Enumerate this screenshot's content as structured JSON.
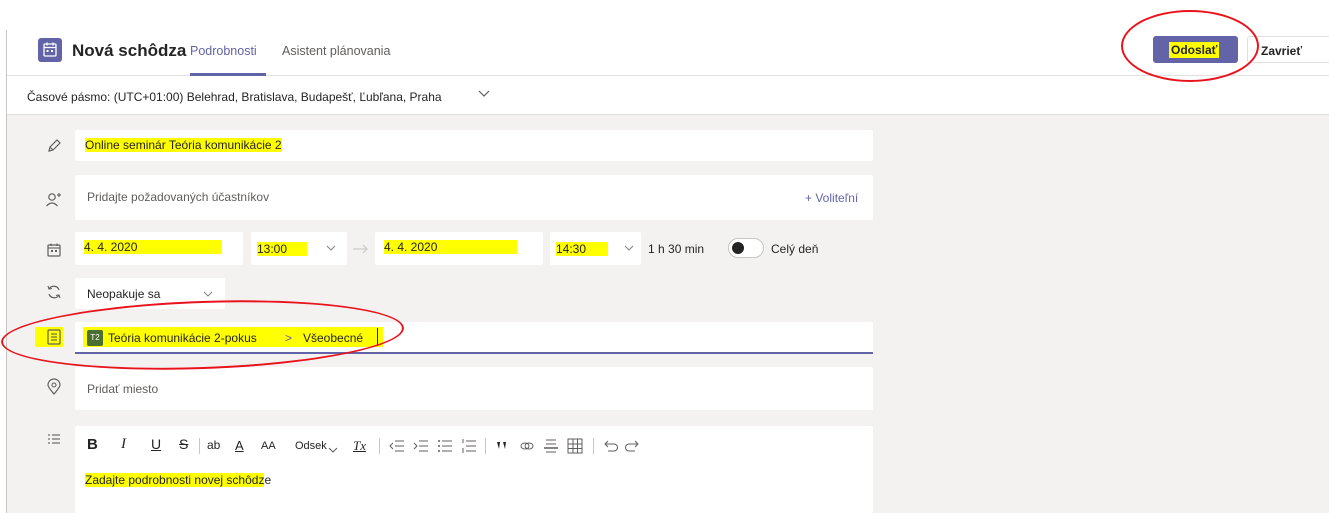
{
  "header": {
    "title": "Nová schôdza",
    "tabs": [
      {
        "label": "Podrobnosti",
        "active": true
      },
      {
        "label": "Asistent plánovania",
        "active": false
      }
    ],
    "send_label": "Odoslať",
    "close_label": "Zavrieť"
  },
  "timezone": {
    "label": "Časové pásmo: (UTC+01:00) Belehrad, Bratislava, Budapešť, Ľubľana, Praha"
  },
  "form": {
    "title_value": "Online seminár Teória komunikácie 2",
    "attendees_placeholder": "Pridajte požadovaných účastníkov",
    "optional_label": "+ Voliteľní",
    "start_date": "4. 4. 2020",
    "start_time": "13:00",
    "end_date": "4. 4. 2020",
    "end_time": "14:30",
    "duration": "1 h 30 min",
    "all_day_label": "Celý deň",
    "all_day_on": false,
    "recurrence": "Neopakuje sa",
    "team_badge": "T2",
    "team": "Teória komunikácie 2-pokus",
    "channel_separator": ">",
    "channel": "Všeobecné",
    "location_placeholder": "Pridať miesto"
  },
  "editor": {
    "toolbar": {
      "bold": "B",
      "italic": "I",
      "underline": "U",
      "strikethrough": "S",
      "highlight": "ab",
      "font_color": "A",
      "font_size": "AA",
      "paragraph": "Odsek",
      "clear_format": "Tx"
    },
    "placeholder_highlighted": "Zadajte podrobnosti novej schôdz",
    "placeholder_rest": "e"
  },
  "colors": {
    "accent": "#6264a7",
    "highlight": "#ffff00",
    "annotation": "#e8141c"
  }
}
